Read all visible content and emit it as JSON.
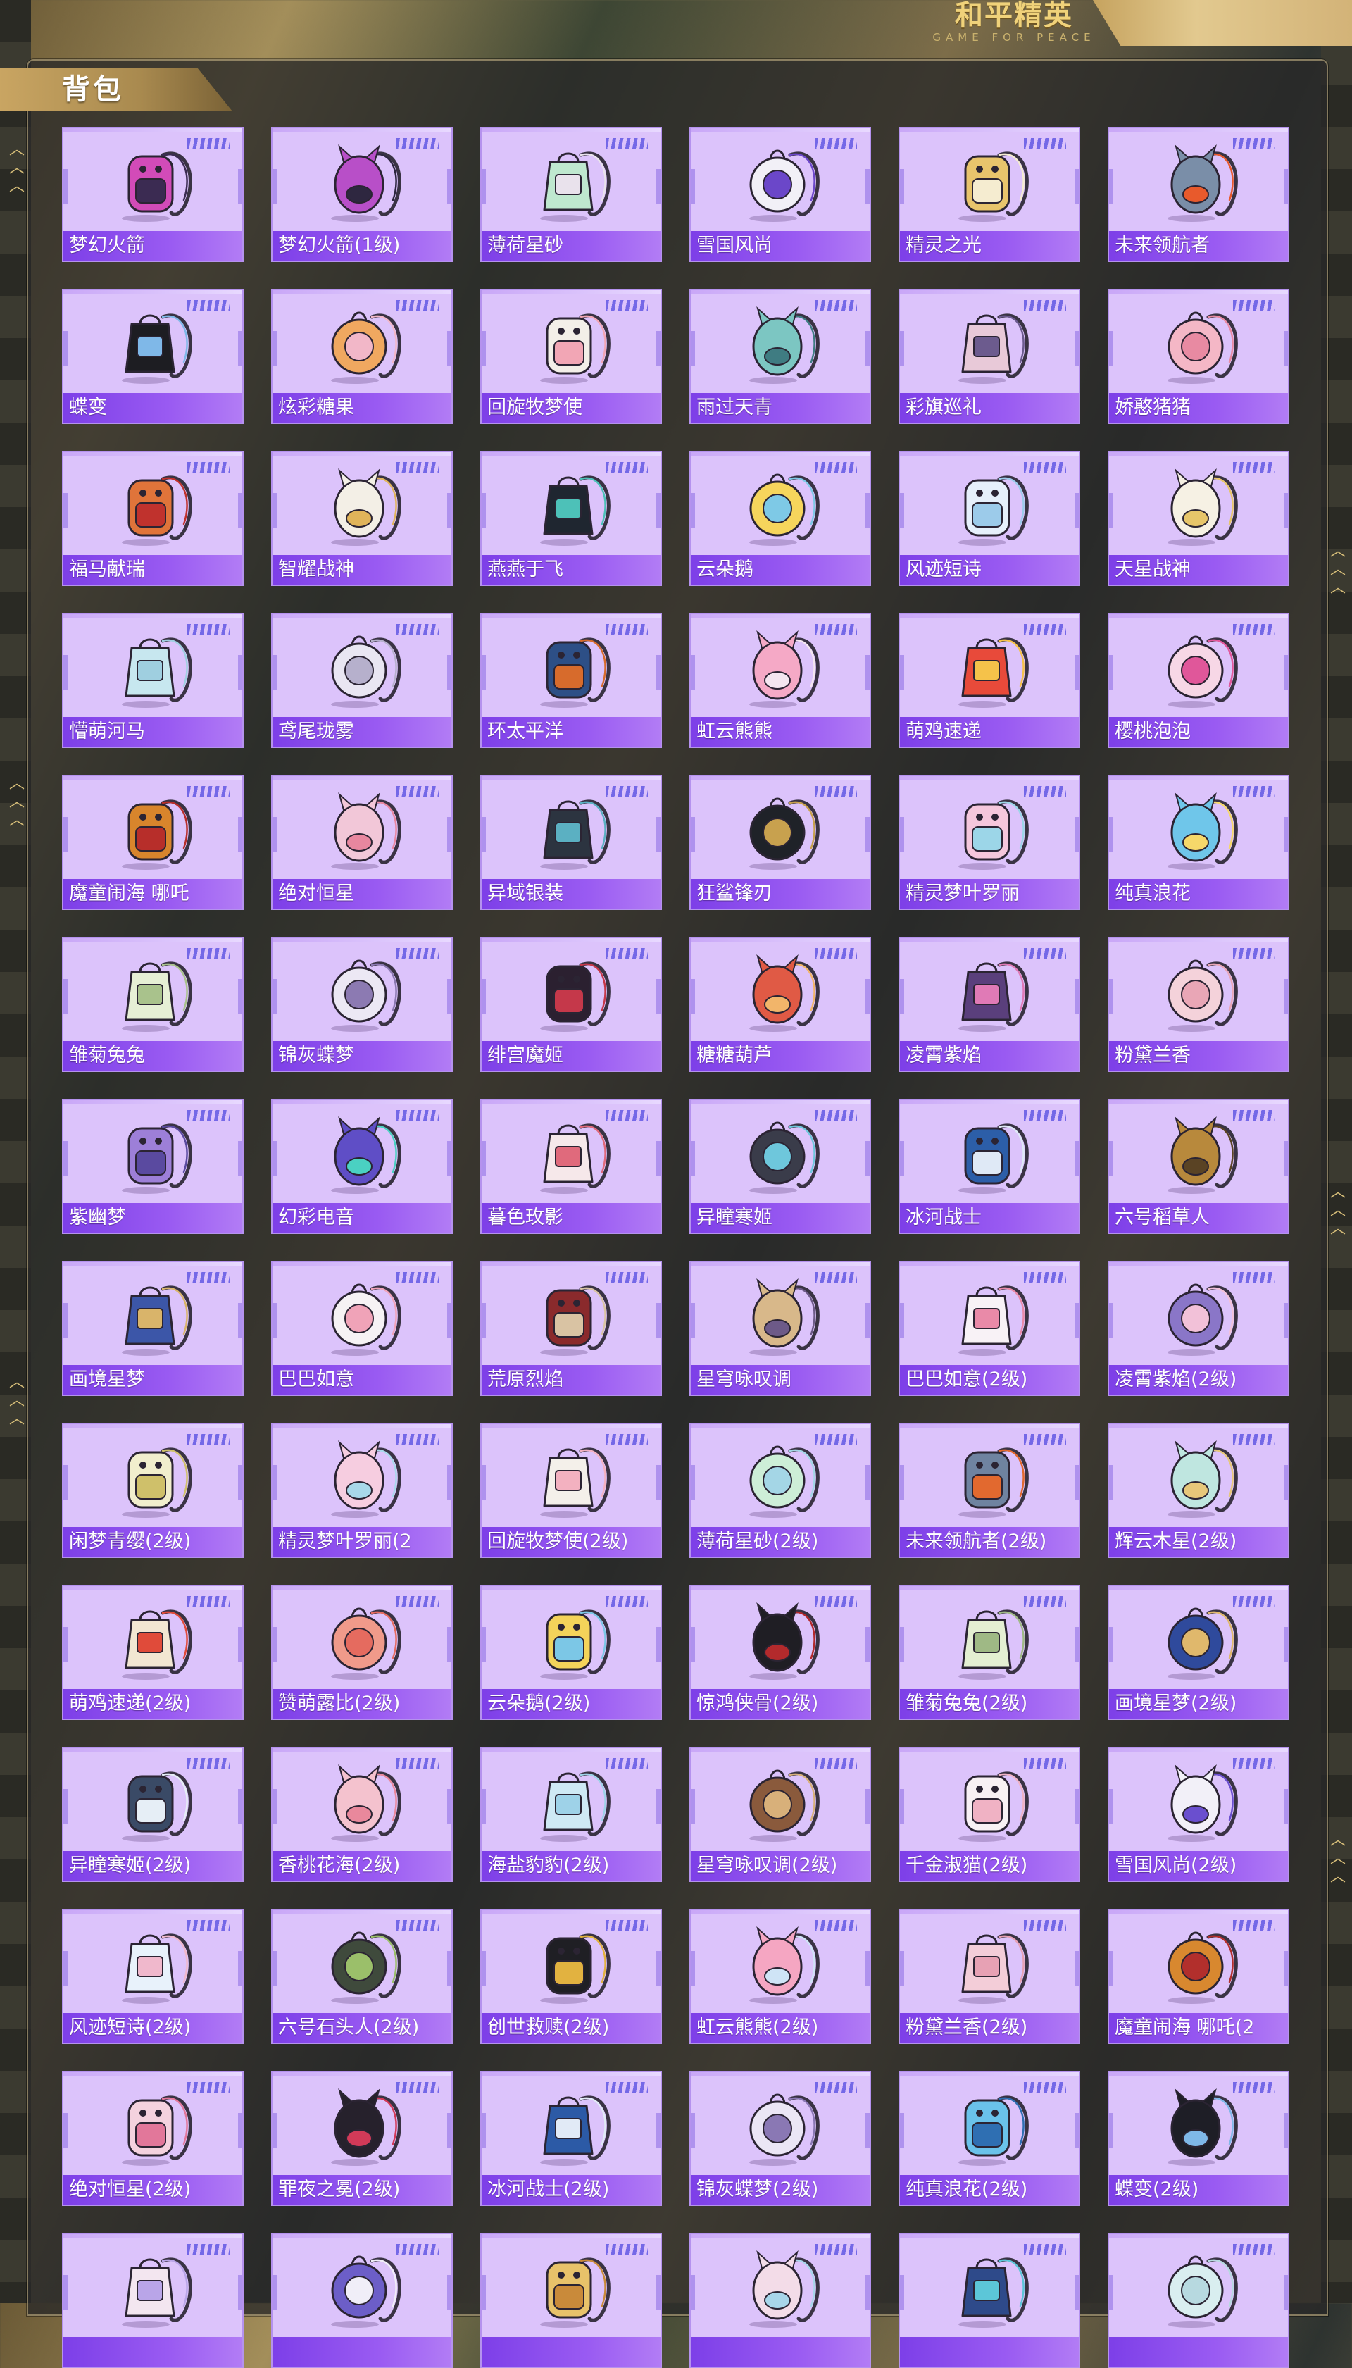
{
  "logo": {
    "text_cn": "和平精英",
    "text_en": "GAME FOR PEACE"
  },
  "page_title": "背包",
  "items": [
    {
      "label": "梦幻火箭",
      "colors": [
        "#d24bb8",
        "#3b2b52"
      ]
    },
    {
      "label": "梦幻火箭(1级)",
      "colors": [
        "#b84fc8",
        "#2e2740"
      ]
    },
    {
      "label": "薄荷星砂",
      "colors": [
        "#bfe8cf",
        "#e9e2ec"
      ]
    },
    {
      "label": "雪国风尚",
      "colors": [
        "#f2f0f7",
        "#6b47c9"
      ]
    },
    {
      "label": "精灵之光",
      "colors": [
        "#e8c46c",
        "#f5ecd0"
      ]
    },
    {
      "label": "未来领航者",
      "colors": [
        "#7a8ea8",
        "#e85a2c"
      ]
    },
    {
      "label": "蝶变",
      "colors": [
        "#1d1d22",
        "#7fb8e8"
      ]
    },
    {
      "label": "炫彩糖果",
      "colors": [
        "#f0a860",
        "#f2b7c8"
      ]
    },
    {
      "label": "回旋牧梦使",
      "colors": [
        "#f3efe8",
        "#f2a6b5"
      ]
    },
    {
      "label": "雨过天青",
      "colors": [
        "#7cc6c2",
        "#3f7c82"
      ]
    },
    {
      "label": "彩旗巡礼",
      "colors": [
        "#e8c9d8",
        "#6c5b8e"
      ]
    },
    {
      "label": "娇憨猪猪",
      "colors": [
        "#f4b7c6",
        "#e88aa2"
      ]
    },
    {
      "label": "福马献瑞",
      "colors": [
        "#e0743a",
        "#c0322d"
      ]
    },
    {
      "label": "智耀战神",
      "colors": [
        "#f3efe6",
        "#e0b45a"
      ]
    },
    {
      "label": "燕燕于飞",
      "colors": [
        "#1f2630",
        "#4dc1b8"
      ]
    },
    {
      "label": "云朵鹅",
      "colors": [
        "#f6d55c",
        "#7ec9e6"
      ]
    },
    {
      "label": "风迹短诗",
      "colors": [
        "#e6f0fb",
        "#9ccbea"
      ]
    },
    {
      "label": "天星战神",
      "colors": [
        "#f6f1e4",
        "#e7c56a"
      ]
    },
    {
      "label": "懵萌河马",
      "colors": [
        "#c7e7ef",
        "#9fcfe0"
      ]
    },
    {
      "label": "鸢尾珑雾",
      "colors": [
        "#e9e6f2",
        "#b6b0cc"
      ]
    },
    {
      "label": "环太平洋",
      "colors": [
        "#2d4f86",
        "#d76b2c"
      ]
    },
    {
      "label": "虹云熊熊",
      "colors": [
        "#f5a9c6",
        "#f4e6f0"
      ]
    },
    {
      "label": "萌鸡速递",
      "colors": [
        "#e84a3a",
        "#f5c24a"
      ]
    },
    {
      "label": "樱桃泡泡",
      "colors": [
        "#f7d7e6",
        "#e0579a"
      ]
    },
    {
      "label": "魔童闹海 哪吒",
      "colors": [
        "#d8852c",
        "#b72e2a"
      ]
    },
    {
      "label": "绝对恒星",
      "colors": [
        "#f2c7d8",
        "#e8879f"
      ]
    },
    {
      "label": "异域银装",
      "colors": [
        "#2c3440",
        "#5bb0c2"
      ]
    },
    {
      "label": "狂鲨锋刃",
      "colors": [
        "#1f2228",
        "#c8a14e"
      ]
    },
    {
      "label": "精灵梦叶罗丽",
      "colors": [
        "#f5c7dc",
        "#9cd6e8"
      ]
    },
    {
      "label": "纯真浪花",
      "colors": [
        "#6fc6ea",
        "#f6d86a"
      ]
    },
    {
      "label": "雏菊兔兔",
      "colors": [
        "#e6efd5",
        "#a9c28c"
      ]
    },
    {
      "label": "锦灰蝶梦",
      "colors": [
        "#ece8f4",
        "#8c7ab2"
      ]
    },
    {
      "label": "绯宫魔姬",
      "colors": [
        "#2b2030",
        "#c5384a"
      ]
    },
    {
      "label": "糖糖葫芦",
      "colors": [
        "#e05a45",
        "#f2b56a"
      ]
    },
    {
      "label": "凌霄紫焰",
      "colors": [
        "#5a3f7c",
        "#e07ab6"
      ]
    },
    {
      "label": "粉黛兰香",
      "colors": [
        "#f4d2da",
        "#e9a6b6"
      ]
    },
    {
      "label": "紫幽梦",
      "colors": [
        "#9d7fd8",
        "#5a4aa0"
      ]
    },
    {
      "label": "幻彩电音",
      "colors": [
        "#5f4ec6",
        "#4ad1c2"
      ]
    },
    {
      "label": "暮色玫影",
      "colors": [
        "#f6e8ea",
        "#e06a7c"
      ]
    },
    {
      "label": "异瞳寒姬",
      "colors": [
        "#3a3c4a",
        "#6ec7dc"
      ]
    },
    {
      "label": "冰河战士",
      "colors": [
        "#2c5ea8",
        "#dfe9f6"
      ]
    },
    {
      "label": "六号稻草人",
      "colors": [
        "#b8893c",
        "#5a4324"
      ]
    },
    {
      "label": "画境星梦",
      "colors": [
        "#3c56a8",
        "#d9b46a"
      ]
    },
    {
      "label": "巴巴如意",
      "colors": [
        "#f6f2f4",
        "#f0a3b8"
      ]
    },
    {
      "label": "荒原烈焰",
      "colors": [
        "#8a2a2c",
        "#d9c3a3"
      ]
    },
    {
      "label": "星穹咏叹调",
      "colors": [
        "#d8b88a",
        "#6d5a88"
      ]
    },
    {
      "label": "巴巴如意(2级)",
      "colors": [
        "#f8f2f6",
        "#e98aa8"
      ]
    },
    {
      "label": "凌霄紫焰(2级)",
      "colors": [
        "#8a76c8",
        "#f2c1d8"
      ]
    },
    {
      "label": "闲梦青缨(2级)",
      "colors": [
        "#f1eecd",
        "#cfc06a"
      ]
    },
    {
      "label": "精灵梦叶罗丽(2",
      "colors": [
        "#f6cde0",
        "#a8d8ea"
      ]
    },
    {
      "label": "回旋牧梦使(2级)",
      "colors": [
        "#f4f0ea",
        "#f3b1c0"
      ]
    },
    {
      "label": "薄荷星砂(2级)",
      "colors": [
        "#cdeed7",
        "#a4d6e6"
      ]
    },
    {
      "label": "未来领航者(2级)",
      "colors": [
        "#6f83a0",
        "#e2692f"
      ]
    },
    {
      "label": "辉云木星(2级)",
      "colors": [
        "#bfe6e0",
        "#e7c77a"
      ]
    },
    {
      "label": "萌鸡速递(2级)",
      "colors": [
        "#f2e6d2",
        "#e04b3a"
      ]
    },
    {
      "label": "赞萌露比(2级)",
      "colors": [
        "#f09a8a",
        "#e56b5f"
      ]
    },
    {
      "label": "云朵鹅(2级)",
      "colors": [
        "#f4d35a",
        "#7cc7e6"
      ]
    },
    {
      "label": "惊鸿侠骨(2级)",
      "colors": [
        "#1f1e24",
        "#b32a2c"
      ]
    },
    {
      "label": "雏菊兔兔(2级)",
      "colors": [
        "#e4efd2",
        "#9fb985"
      ]
    },
    {
      "label": "画境星梦(2级)",
      "colors": [
        "#2f4a9c",
        "#e0b86c"
      ]
    },
    {
      "label": "异瞳寒姬(2级)",
      "colors": [
        "#3a4a66",
        "#e6eef6"
      ]
    },
    {
      "label": "香桃花海(2级)",
      "colors": [
        "#f4c2ce",
        "#e9889c"
      ]
    },
    {
      "label": "海盐豹豹(2级)",
      "colors": [
        "#cfe9f4",
        "#9ed2e8"
      ]
    },
    {
      "label": "星穹咏叹调(2级)",
      "colors": [
        "#8a5a3c",
        "#d8b07a"
      ]
    },
    {
      "label": "千金淑猫(2级)",
      "colors": [
        "#f8f1f4",
        "#f0b2c4"
      ]
    },
    {
      "label": "雪国风尚(2级)",
      "colors": [
        "#f2f0f8",
        "#6a4fcf"
      ]
    },
    {
      "label": "风迹短诗(2级)",
      "colors": [
        "#e8f2fb",
        "#f0b8cc"
      ]
    },
    {
      "label": "六号石头人(2级)",
      "colors": [
        "#3f4a3c",
        "#9bbf6a"
      ]
    },
    {
      "label": "创世救赎(2级)",
      "colors": [
        "#1f1f24",
        "#e2b240"
      ]
    },
    {
      "label": "虹云熊熊(2级)",
      "colors": [
        "#f5a6c2",
        "#cfe4f6"
      ]
    },
    {
      "label": "粉黛兰香(2级)",
      "colors": [
        "#f3cdd8",
        "#e7a1b4"
      ]
    },
    {
      "label": "魔童闹海 哪吒(2",
      "colors": [
        "#d8882f",
        "#b22f2c"
      ]
    },
    {
      "label": "绝对恒星(2级)",
      "colors": [
        "#f4d2de",
        "#e2779a"
      ]
    },
    {
      "label": "罪夜之冕(2级)",
      "colors": [
        "#26212c",
        "#d23a58"
      ]
    },
    {
      "label": "冰河战士(2级)",
      "colors": [
        "#2c5aa6",
        "#e1eaf6"
      ]
    },
    {
      "label": "锦灰蝶梦(2级)",
      "colors": [
        "#ebe6f5",
        "#8a78b4"
      ]
    },
    {
      "label": "纯真浪花(2级)",
      "colors": [
        "#6ac2ea",
        "#2f6fb2"
      ]
    },
    {
      "label": "蝶变(2级)",
      "colors": [
        "#1e1e26",
        "#7fb8e8"
      ]
    },
    {
      "label": "",
      "colors": [
        "#f3e6f0",
        "#b9a5e8"
      ]
    },
    {
      "label": "",
      "colors": [
        "#6c5ec8",
        "#f0eef8"
      ]
    },
    {
      "label": "",
      "colors": [
        "#e8c26a",
        "#c98a3a"
      ]
    },
    {
      "label": "",
      "colors": [
        "#f3dce8",
        "#a8d6ea"
      ]
    },
    {
      "label": "",
      "colors": [
        "#2e4a8a",
        "#5cc6d8"
      ]
    },
    {
      "label": "",
      "colors": [
        "#d9eef0",
        "#b7d9e0"
      ]
    }
  ]
}
